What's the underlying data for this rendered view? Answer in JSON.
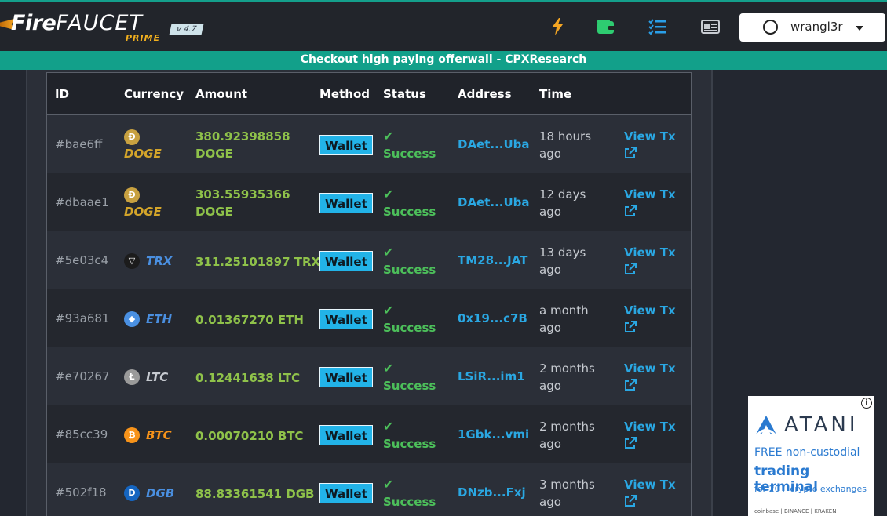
{
  "header": {
    "logo_fire": "Fire",
    "logo_faucet": "FAUCET",
    "logo_prime": "PRIME",
    "version": "v 4.7",
    "icons": [
      "lightning-icon",
      "wallet-icon",
      "tasks-icon",
      "ptc-ads-icon"
    ],
    "username": "wrangl3r"
  },
  "banner": {
    "text": "Checkout high paying offerwall - ",
    "link": "CPXResearch"
  },
  "table": {
    "columns": [
      "ID",
      "Currency",
      "Amount",
      "Method",
      "Status",
      "Address",
      "Time"
    ],
    "rows": [
      {
        "id": "#bae6ff",
        "currency": "DOGE",
        "coin_icon": "doge-coin-icon",
        "amount_line1": "380.92398858",
        "amount_line2": "DOGE",
        "method": "Wallet",
        "status": "Success",
        "address": "DAet...Uba",
        "time_line1": "18 hours",
        "time_line2": "ago",
        "view": "View Tx"
      },
      {
        "id": "#dbaae1",
        "currency": "DOGE",
        "coin_icon": "doge-coin-icon",
        "amount_line1": "303.55935366",
        "amount_line2": "DOGE",
        "method": "Wallet",
        "status": "Success",
        "address": "DAet...Uba",
        "time_line1": "12 days",
        "time_line2": "ago",
        "view": "View Tx"
      },
      {
        "id": "#5e03c4",
        "currency": "TRX",
        "coin_icon": "trx-coin-icon",
        "amount_line1": "311.25101897 TRX",
        "amount_line2": "",
        "method": "Wallet",
        "status": "Success",
        "address": "TM28...JAT",
        "time_line1": "13 days",
        "time_line2": "ago",
        "view": "View Tx"
      },
      {
        "id": "#93a681",
        "currency": "ETH",
        "coin_icon": "eth-coin-icon",
        "amount_line1": "0.01367270 ETH",
        "amount_line2": "",
        "method": "Wallet",
        "status": "Success",
        "address": "0x19...c7B",
        "time_line1": "a month",
        "time_line2": "ago",
        "view": "View Tx"
      },
      {
        "id": "#e70267",
        "currency": "LTC",
        "coin_icon": "ltc-coin-icon",
        "amount_line1": "0.12441638 LTC",
        "amount_line2": "",
        "method": "Wallet",
        "status": "Success",
        "address": "LSiR...im1",
        "time_line1": "2 months",
        "time_line2": "ago",
        "view": "View Tx"
      },
      {
        "id": "#85cc39",
        "currency": "BTC",
        "coin_icon": "btc-coin-icon",
        "amount_line1": "0.00070210 BTC",
        "amount_line2": "",
        "method": "Wallet",
        "status": "Success",
        "address": "1Gbk...vmi",
        "time_line1": "2 months",
        "time_line2": "ago",
        "view": "View Tx"
      },
      {
        "id": "#502f18",
        "currency": "DGB",
        "coin_icon": "dgb-coin-icon",
        "amount_line1": "88.83361541 DGB",
        "amount_line2": "",
        "method": "Wallet",
        "status": "Success",
        "address": "DNzb...Fxj",
        "time_line1": "3 months",
        "time_line2": "ago",
        "view": "View Tx"
      }
    ]
  },
  "ad": {
    "brand": "ATANI",
    "line1": "FREE non-custodial",
    "line2": "trading terminal",
    "line3": "for 20+ crypto exchanges",
    "footer": "coinbase | BINANCE | KRAKEN"
  },
  "colors": {
    "accent": "#12a08a",
    "amount_green": "#8fc24a",
    "link_blue": "#2aa7e2",
    "wallet_badge": "#22b3e8"
  }
}
